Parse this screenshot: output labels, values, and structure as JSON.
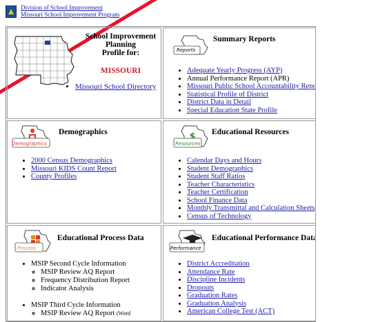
{
  "header": {
    "link1": "Division of School Improvement",
    "link2": "Missouri School Improvement Program"
  },
  "profile": {
    "line1": "School Improvement",
    "line2": "Planning",
    "line3": "Profile for:",
    "state": "MISSOURI",
    "directory_link": "Missouri School Directory"
  },
  "summary": {
    "icon_label": "Reports",
    "title": "Summary Reports",
    "items": [
      {
        "text": "Adequate Yearly Progress (AYP)",
        "link": true
      },
      {
        "text": "Annual Performance Report (APR)",
        "link": false
      },
      {
        "text": "Missouri Public School Accountability Report",
        "link": true
      },
      {
        "text": "Statistical Profile of District",
        "link": true
      },
      {
        "text": "District Data in Detail",
        "link": true
      },
      {
        "text": "Special Education State Profile",
        "link": true
      }
    ]
  },
  "demographics": {
    "icon_label": "Demographics",
    "title": "Demographics",
    "items": [
      {
        "text": "2000 Census Demographics",
        "link": true
      },
      {
        "text": "Missouri KIDS Count Report",
        "link": true
      },
      {
        "text": "County Profiles",
        "link": true
      }
    ]
  },
  "resources": {
    "icon_label": "Resources",
    "title": "Educational Resources",
    "items": [
      {
        "text": "Calendar Days and Hours",
        "link": true
      },
      {
        "text": "Student Demographics",
        "link": true
      },
      {
        "text": "Student Staff Ratios",
        "link": true
      },
      {
        "text": "Teacher Characteristics",
        "link": true
      },
      {
        "text": "Teacher Certification",
        "link": true
      },
      {
        "text": "School Finance Data",
        "link": true
      },
      {
        "text": "Monthly Transmittal and Calculation Sheets",
        "link": true
      },
      {
        "text": "Census of Technology",
        "link": true
      }
    ]
  },
  "process": {
    "icon_label": "Process",
    "title": "Educational Process Data",
    "second_cycle": "MSIP Second Cycle Information",
    "second_sub": [
      "MSIP Review AQ Report",
      "Frequency Distribution Report",
      "Indicator Analysis"
    ],
    "third_cycle": "MSIP Third Cycle Information",
    "third_sub": [
      "MSIP Review AQ Report"
    ],
    "third_sub_note": "(Word"
  },
  "performance": {
    "icon_label": "Performance",
    "title": "Educational Performance Data",
    "items": [
      {
        "text": "District Accreditation",
        "link": true
      },
      {
        "text": "Attendance Rate",
        "link": true
      },
      {
        "text": "Discipline Incidents",
        "link": true
      },
      {
        "text": "Dropouts",
        "link": true
      },
      {
        "text": "Graduation Rates",
        "link": true
      },
      {
        "text": "Graduation Analysis",
        "link": true
      },
      {
        "text": "American College Test (ACT)",
        "link": true
      }
    ]
  },
  "colors": {
    "link": "#1a1aa6",
    "state": "#c8202a",
    "slash": "#e8112d",
    "icon_red": "#d8362c",
    "icon_orange": "#e48a1c",
    "icon_green": "#2a8a2a"
  }
}
